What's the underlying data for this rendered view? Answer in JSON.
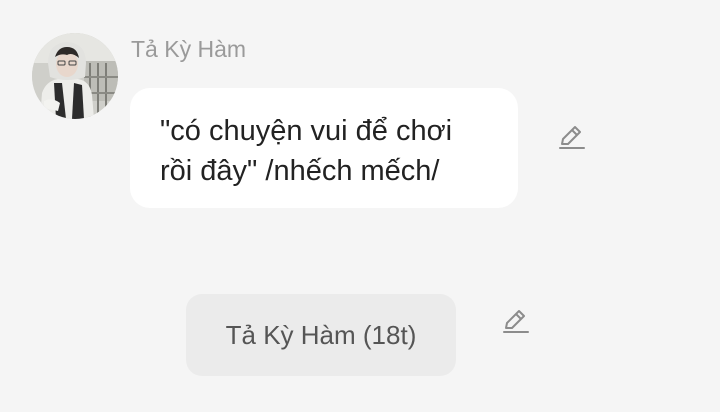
{
  "message": {
    "sender_name": "Tả Kỳ Hàm",
    "text": "\"có chuyện vui để chơi\nrồi đây\" /nhếch mếch/",
    "avatar_icon": "avatar-photo",
    "edit_icon": "pencil-icon"
  },
  "name_chip": {
    "label": "Tả Kỳ Hàm (18t)",
    "edit_icon": "pencil-icon"
  },
  "colors": {
    "background": "#f5f5f5",
    "bubble": "#ffffff",
    "chip": "#ebebeb",
    "icon": "#8c8c8c",
    "name": "#9a9a9a"
  }
}
